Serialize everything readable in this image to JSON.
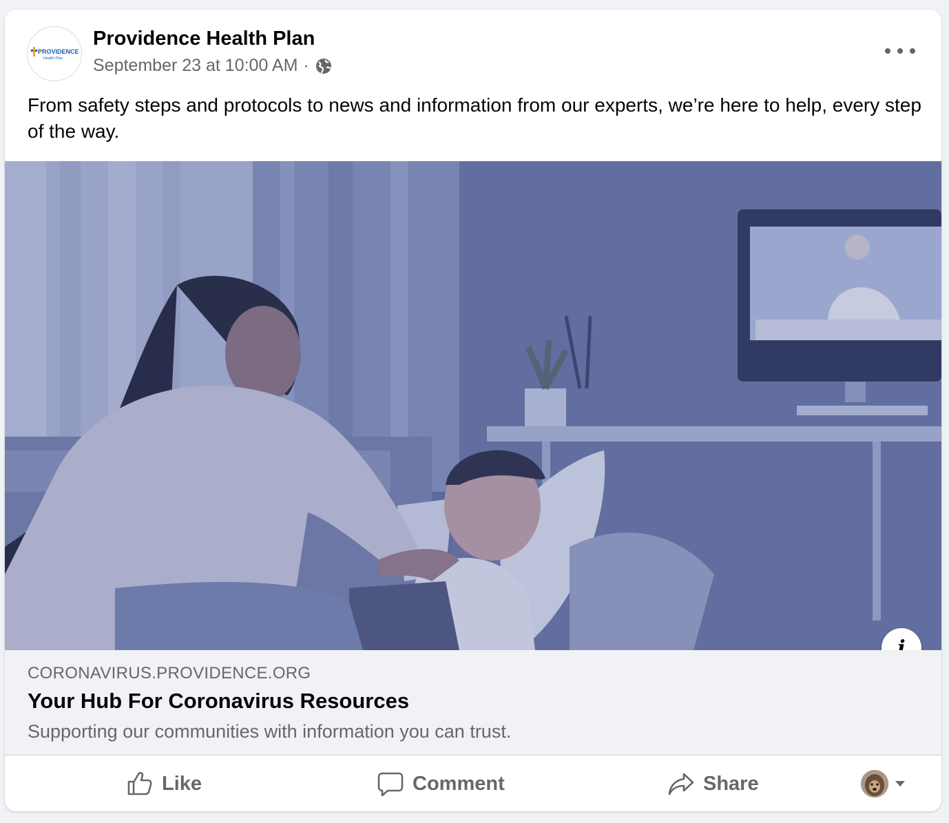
{
  "post": {
    "page_name": "Providence Health Plan",
    "timestamp": "September 23 at 10:00 AM",
    "separator": "·",
    "privacy_icon": "globe-icon",
    "text": "From safety steps and protocols to news and information from our experts, we’re here to help, every step of the way.",
    "avatar": {
      "logo_text": "PROVIDENCE",
      "logo_subtext": "Health Plan"
    }
  },
  "link_preview": {
    "domain": "CORONAVIRUS.PROVIDENCE.ORG",
    "title": "Your Hub For Coronavirus Resources",
    "description": "Supporting our communities with information you can trust.",
    "info_label": "i"
  },
  "actions": {
    "like": "Like",
    "comment": "Comment",
    "share": "Share"
  },
  "colors": {
    "brand_blue": "#1b5fa8",
    "brand_orange": "#f4a51c",
    "secondary_text": "#65676b",
    "photo_tint": "#5d6a96"
  }
}
